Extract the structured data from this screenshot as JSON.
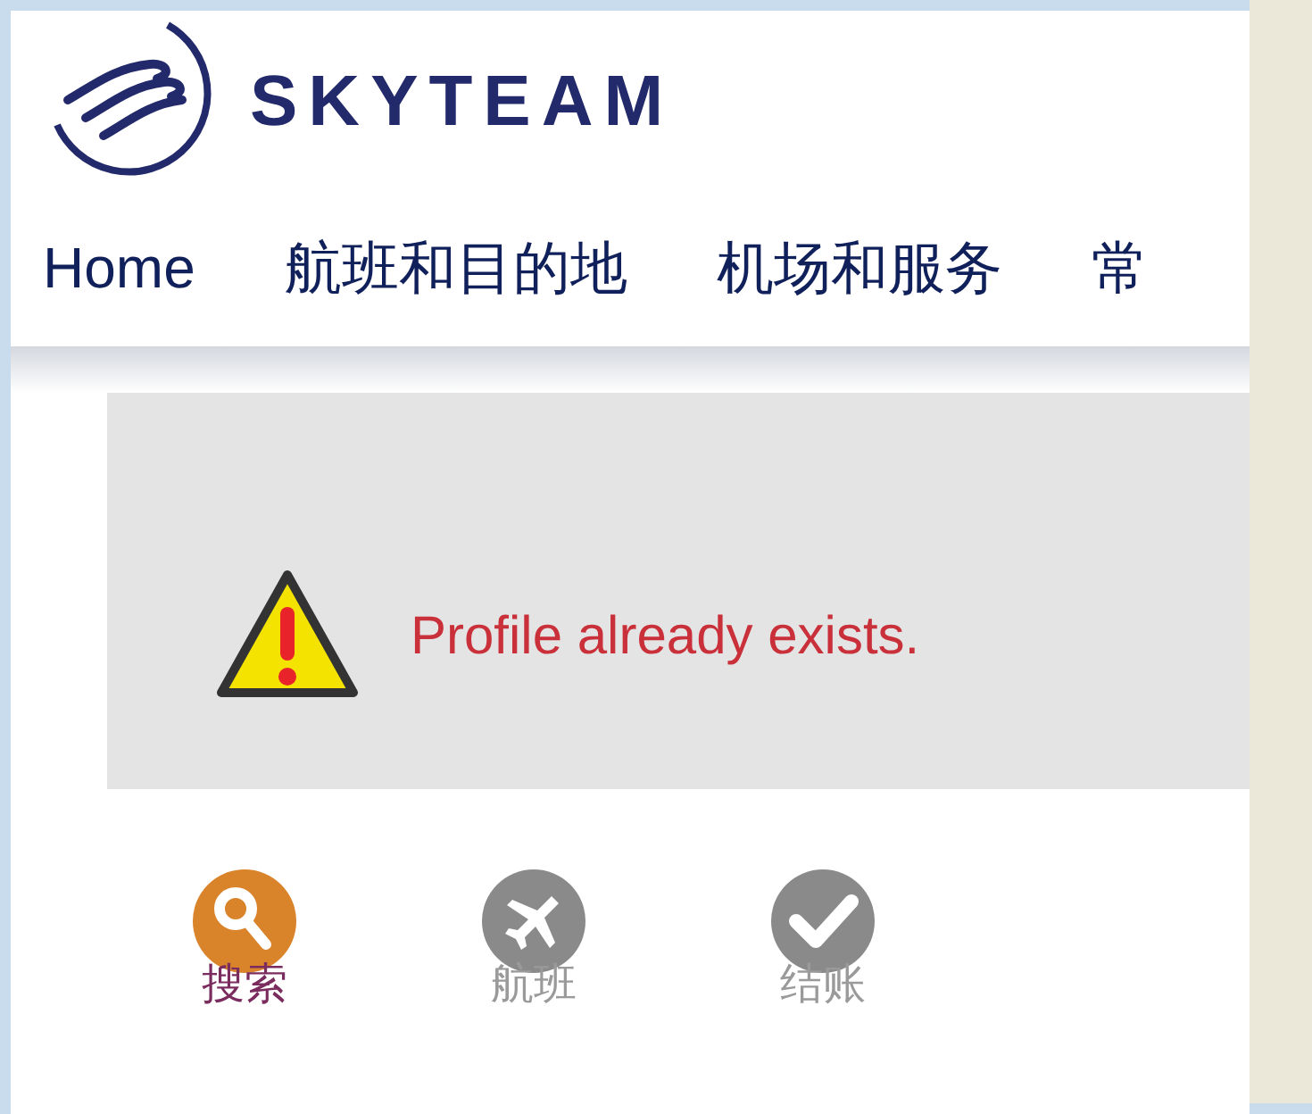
{
  "logo": {
    "text": "SKYTEAM"
  },
  "nav": [
    "Home",
    "航班和目的地",
    "机场和服务",
    "常"
  ],
  "alert": {
    "message": "Profile already exists."
  },
  "steps": [
    {
      "kind": "search",
      "label": "搜索",
      "selected": true
    },
    {
      "kind": "flight",
      "label": "航班",
      "selected": false
    },
    {
      "kind": "checkout",
      "label": "结账",
      "selected": false
    }
  ]
}
